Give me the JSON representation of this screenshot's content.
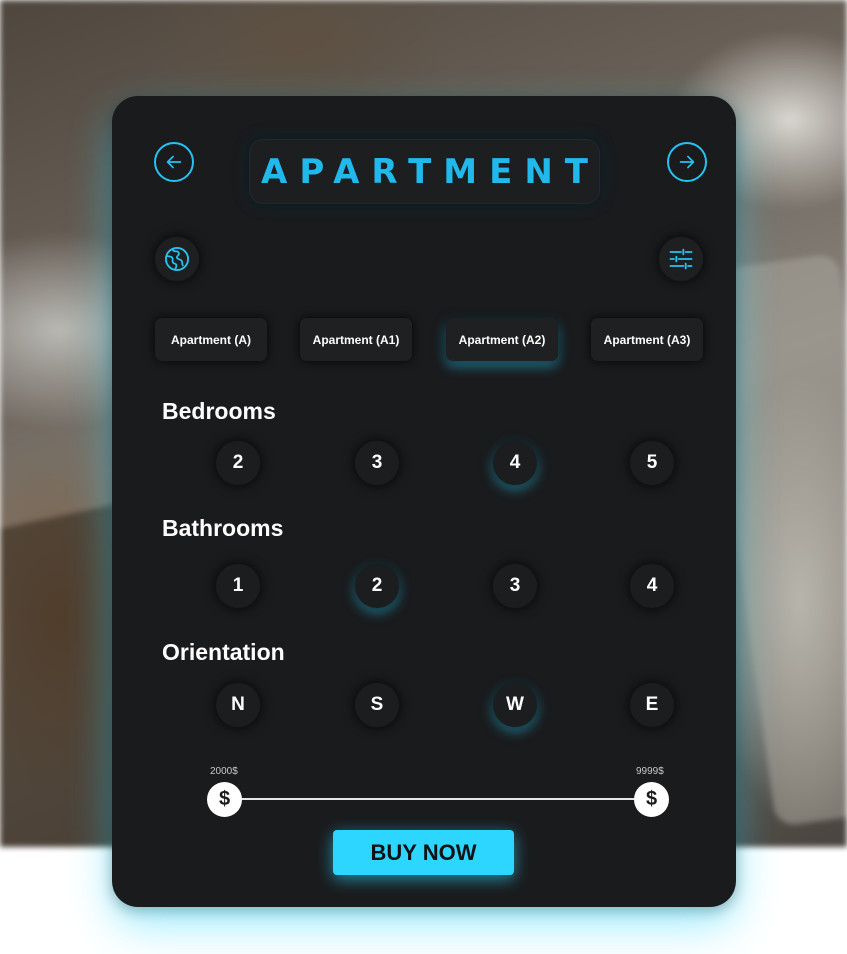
{
  "header": {
    "title": "APARTMENT",
    "prev_icon": "arrow-left-circle",
    "next_icon": "arrow-right-circle"
  },
  "tools": {
    "globe_icon": "globe-icon",
    "filter_icon": "sliders-icon"
  },
  "apartments": {
    "tabs": [
      "Apartment (A)",
      "Apartment (A1)",
      "Apartment (A2)",
      "Apartment (A3)"
    ],
    "selected": "Apartment (A2)"
  },
  "bedrooms": {
    "label": "Bedrooms",
    "options": [
      "2",
      "3",
      "4",
      "5"
    ],
    "selected": "4"
  },
  "bathrooms": {
    "label": "Bathrooms",
    "options": [
      "1",
      "2",
      "3",
      "4"
    ],
    "selected": "2"
  },
  "orientation": {
    "label": "Orientation",
    "options": [
      "N",
      "S",
      "W",
      "E"
    ],
    "selected": "W"
  },
  "price": {
    "min_label": "2000$",
    "max_label": "9999$",
    "handle_symbol": "$"
  },
  "cta": {
    "label": "BUY NOW"
  },
  "colors": {
    "accent": "#2cd6ff",
    "title": "#21b9ec",
    "card": "#1a1b1d"
  }
}
